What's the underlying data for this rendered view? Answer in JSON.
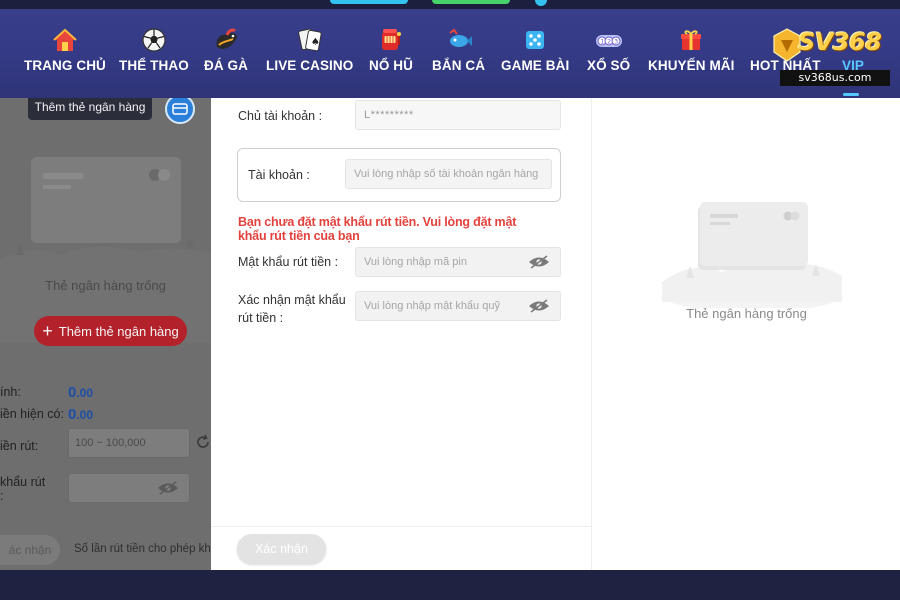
{
  "nav": {
    "items": [
      {
        "label": "TRANG CHỦ",
        "icon": "home-icon"
      },
      {
        "label": "THỂ THAO",
        "icon": "soccer-ball-icon"
      },
      {
        "label": "ĐÁ GÀ",
        "icon": "rooster-icon"
      },
      {
        "label": "LIVE CASINO",
        "icon": "playing-cards-icon"
      },
      {
        "label": "NỔ HŨ",
        "icon": "slot-machine-icon"
      },
      {
        "label": "BẮN CÁ",
        "icon": "fish-icon"
      },
      {
        "label": "GAME BÀI",
        "icon": "dice-icon"
      },
      {
        "label": "XỔ SỐ",
        "icon": "lottery-balls-icon"
      },
      {
        "label": "KHUYẾN MÃI",
        "icon": "gift-icon"
      },
      {
        "label": "HOT NHẤT",
        "icon": "fire-icon"
      },
      {
        "label": "VIP",
        "icon": "vip-icon"
      }
    ],
    "logo_text": "SV368",
    "logo_badge": "sv368us.com"
  },
  "background": {
    "tooltip": "Thêm thẻ ngân hàng",
    "empty_label": "Thẻ ngân hàng trống",
    "add_button": "Thêm thẻ ngân hàng",
    "row1_label": "ính:",
    "row1_amount": "0",
    "row1_decimals": ".00",
    "row2_label": "iền hiện có:",
    "row2_amount": "0",
    "row2_decimals": ".00",
    "row3_label": "iền rút:",
    "row3_placeholder": "100 ~ 100,000",
    "row4_label": "khẩu rút",
    "submit": "ác nhận",
    "note": "Số lần rút tiền cho phép khả"
  },
  "modal": {
    "owner_label": "Chủ tài khoản :",
    "owner_value": "L*********",
    "account_label": "Tài khoản :",
    "account_placeholder": "Vui lòng nhập số tài khoản ngân hàng",
    "warning": "Bạn chưa đặt mật khẩu rút tiền. Vui lòng đặt mật khẩu rút tiền của bạn",
    "pin_label": "Mật khẩu rút tiền :",
    "pin_placeholder": "Vui lòng nhập mã pin",
    "confirm_label_line1": "Xác nhận mật khẩu",
    "confirm_label_line2": "rút tiền :",
    "confirm_placeholder": "Vui lòng nhập mật khẩu quỹ",
    "submit": "Xác nhận"
  },
  "right_panel": {
    "empty_label": "Thẻ ngân hàng trống"
  },
  "colors": {
    "nav_bg": "#343a85",
    "warning": "#e2423d",
    "add_button": "#b3212b",
    "amount": "#1d4fa8"
  }
}
